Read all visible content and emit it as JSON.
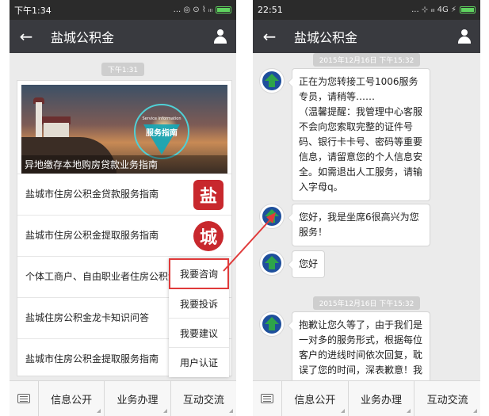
{
  "left": {
    "statusbar": {
      "time": "下午1:34",
      "indicators": "... ◎ ⊙ ⌇ ᵢₗₗ"
    },
    "navbar": {
      "title": "盐城公积金"
    },
    "timestamp": "下午1:31",
    "card": {
      "banner_emblem_small": "Service Information",
      "banner_emblem_title": "服务指南",
      "banner_caption": "异地缴存本地购房贷款业务指南",
      "rows": [
        {
          "text": "盐城市住房公积金贷款服务指南",
          "thumb": "盐",
          "thumb_color": "#c8282d"
        },
        {
          "text": "盐城市住房公积金提取服务指南",
          "thumb": "城",
          "thumb_color": "#c8282d"
        },
        {
          "text": "个体工商户、自由职业者住房公积金业务指南",
          "thumb": ""
        },
        {
          "text": "盐城住房公积金龙卡知识问答",
          "thumb": ""
        },
        {
          "text": "盐城市住房公积金提取服务指南",
          "thumb": ""
        }
      ]
    },
    "popup": [
      "我要咨询",
      "我要投诉",
      "我要建议",
      "用户认证"
    ],
    "menu": [
      "信息公开",
      "业务办理",
      "互动交流"
    ]
  },
  "right": {
    "statusbar": {
      "time": "22:51",
      "indicators": "... ⊹ ᵢₗₗ 4G ⚡"
    },
    "navbar": {
      "title": "盐城公积金"
    },
    "timestamps": [
      "2015年12月16日 下午15:32",
      "2015年12月16日 下午15:32"
    ],
    "messages": [
      "正在为您转接工号1006服务专员，请稍等……\n（温馨提醒：我管理中心客服不会向您索取完整的证件号码、银行卡卡号、密码等重要信息，请留意您的个人信息安全。如需退出人工服务，请输入字母q。",
      "您好，我是坐席6很高兴为您服务！",
      "您好",
      "抱歉让您久等了，由于我们是一对多的服务形式，根据每位客户的进线时间依次回复，耽误了您的时间，深表歉意！我"
    ],
    "menu": [
      "信息公开",
      "业务办理",
      "互动交流"
    ]
  },
  "colors": {
    "accent_red": "#e03a3a",
    "navbar": "#393a3f",
    "avatar_green": "#2ea44a",
    "avatar_blue": "#1e4f9c"
  }
}
